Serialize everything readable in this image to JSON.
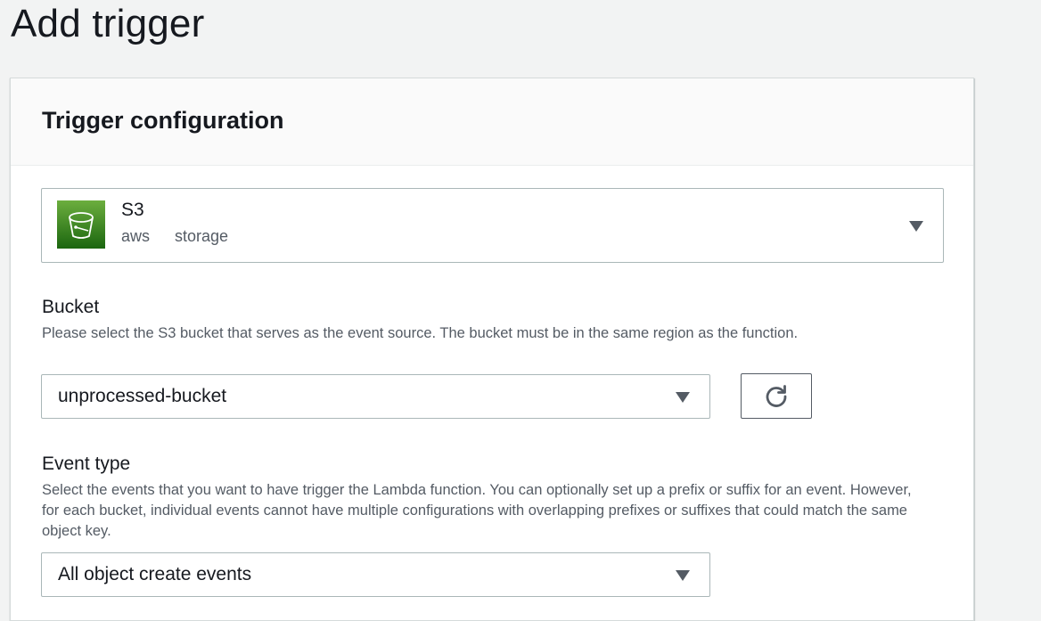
{
  "page": {
    "title": "Add trigger"
  },
  "panel": {
    "title": "Trigger configuration"
  },
  "service": {
    "name": "S3",
    "tags": [
      "aws",
      "storage"
    ],
    "icon": "s3-bucket-icon",
    "logo_color": "#3f8624"
  },
  "bucket": {
    "label": "Bucket",
    "description": "Please select the S3 bucket that serves as the event source. The bucket must be in the same region as the function.",
    "value": "unprocessed-bucket",
    "refresh_icon": "refresh-icon"
  },
  "event_type": {
    "label": "Event type",
    "description": "Select the events that you want to have trigger the Lambda function. You can optionally set up a prefix or suffix for an event. However, for each bucket, individual events cannot have multiple configurations with overlapping prefixes or suffixes that could match the same object key.",
    "value": "All object create events"
  }
}
